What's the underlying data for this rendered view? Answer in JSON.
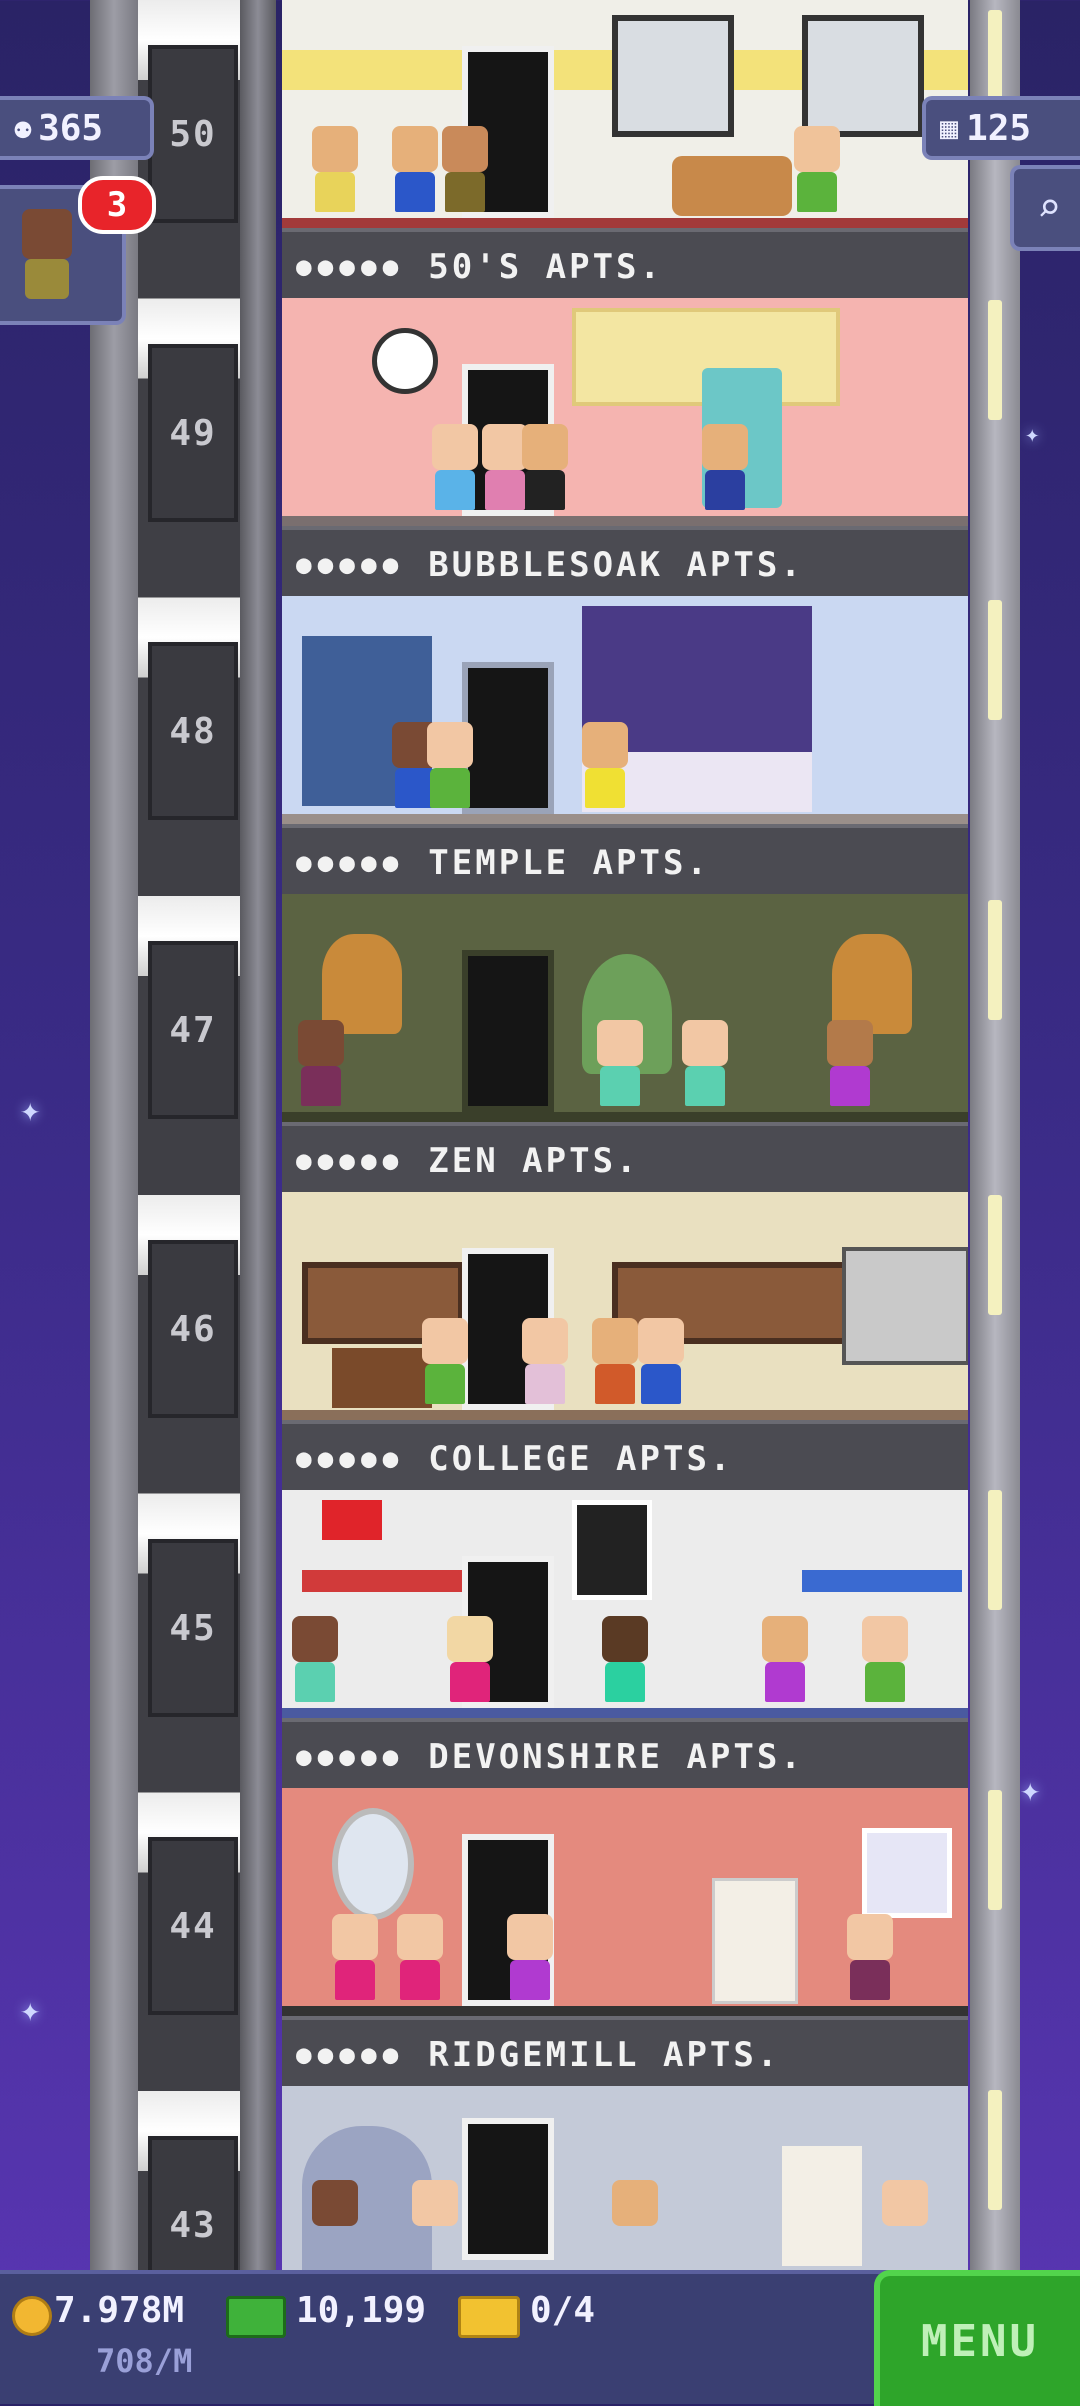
{
  "hud": {
    "population": "365",
    "notification_count": "3",
    "floors_count": "125"
  },
  "floors": [
    {
      "number": "50",
      "name": "50'S APTS.",
      "pips": "●●●●●",
      "bg": "#f0efe8",
      "accent": "#f3e27a"
    },
    {
      "number": "49",
      "name": "BUBBLESOAK APTS.",
      "pips": "●●●●●",
      "bg": "#f5b4b0",
      "accent": "#f3e6a2"
    },
    {
      "number": "48",
      "name": "TEMPLE APTS.",
      "pips": "●●●●●",
      "bg": "#cad8f2",
      "accent": "#7a5db8"
    },
    {
      "number": "47",
      "name": "ZEN APTS.",
      "pips": "●●●●●",
      "bg": "#5b6342",
      "accent": "#6da05a"
    },
    {
      "number": "46",
      "name": "COLLEGE APTS.",
      "pips": "●●●●●",
      "bg": "#e9e0c0",
      "accent": "#b88c5a"
    },
    {
      "number": "45",
      "name": "DEVONSHIRE APTS.",
      "pips": "●●●●●",
      "bg": "#ececec",
      "accent": "#d2b690"
    },
    {
      "number": "44",
      "name": "RIDGEMILL APTS.",
      "pips": "●●●●●",
      "bg": "#e48a7e",
      "accent": "#f3efe6"
    },
    {
      "number": "43",
      "name": "",
      "pips": "",
      "bg": "#c4cad8",
      "accent": "#8f98b8"
    }
  ],
  "bottom": {
    "coins": "7.978M",
    "coins_rate": "708/M",
    "bux": "10,199",
    "tickets": "0/4",
    "menu_label": "MENU"
  },
  "colors": {
    "coin": "#f2b731",
    "bux": "#3fb23a",
    "ticket": "#f2c230",
    "badge": "#e8242a",
    "menu": "#2ea52a"
  }
}
